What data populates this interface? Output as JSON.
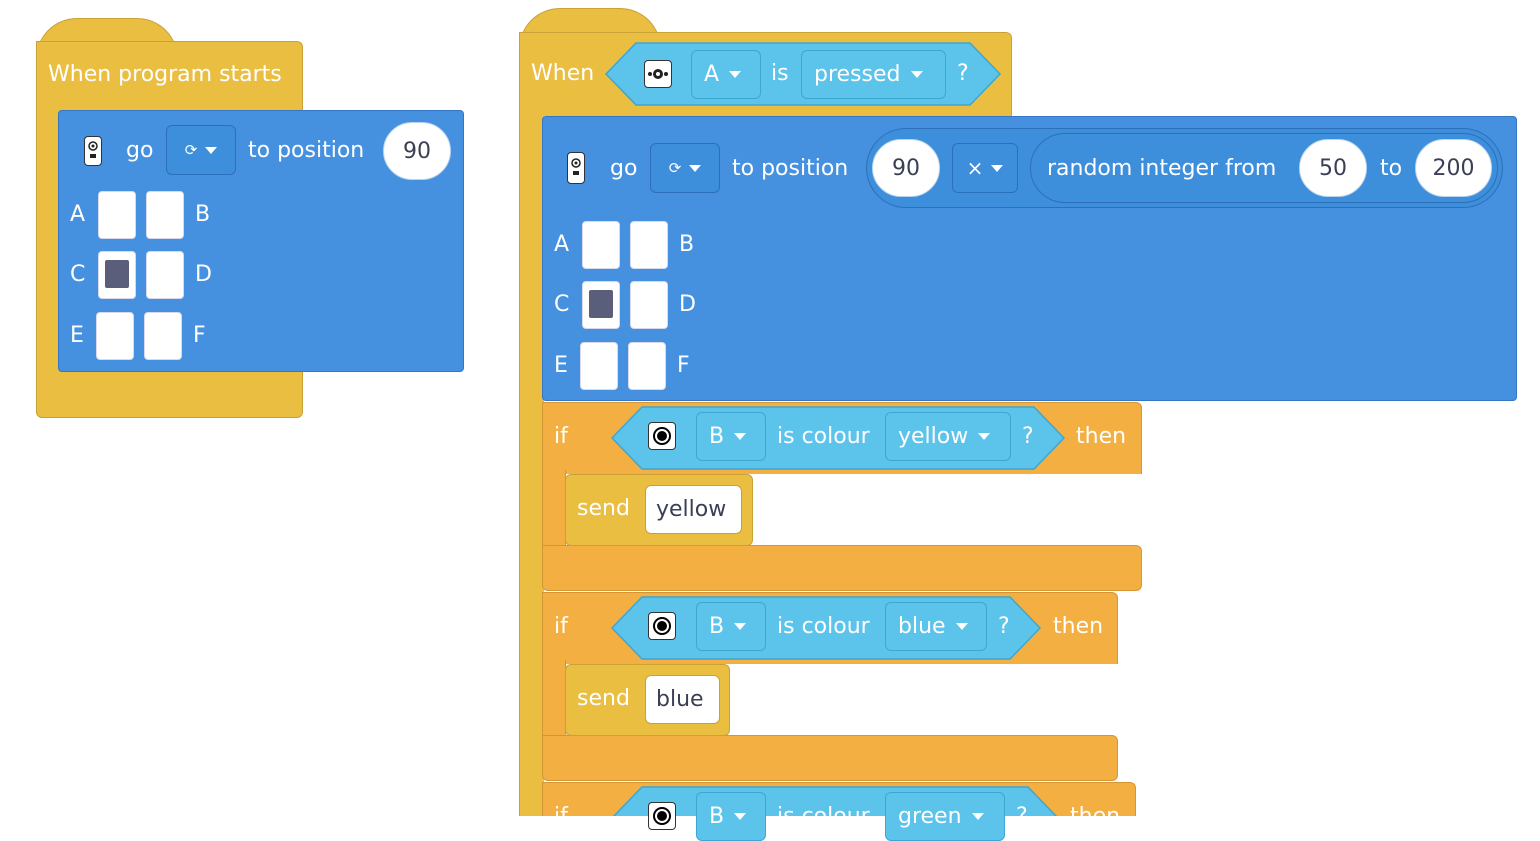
{
  "script1": {
    "hat_label": "When program starts",
    "go_label": "go",
    "direction_symbol": "⟳",
    "to_position_label": "to position",
    "position_value": "90",
    "grid_labels": [
      "A",
      "B",
      "C",
      "D",
      "E",
      "F"
    ],
    "selected_cell": "C"
  },
  "script2": {
    "hat_when": "When",
    "hat_button": "A",
    "hat_is": "is",
    "hat_state": "pressed",
    "hat_q": "?",
    "go_label": "go",
    "direction_symbol": "⟳",
    "to_position_label": "to position",
    "position_value": "90",
    "operator": "×",
    "random_label": "random integer from",
    "random_from": "50",
    "random_to_label": "to",
    "random_to": "200",
    "grid_labels": [
      "A",
      "B",
      "C",
      "D",
      "E",
      "F"
    ],
    "selected_cell": "C",
    "if_blocks": [
      {
        "if": "if",
        "sensor": "B",
        "is_colour": "is colour",
        "colour": "yellow",
        "q": "?",
        "then": "then",
        "send": "send",
        "message": "yellow"
      },
      {
        "if": "if",
        "sensor": "B",
        "is_colour": "is colour",
        "colour": "blue",
        "q": "?",
        "then": "then",
        "send": "send",
        "message": "blue"
      },
      {
        "if": "if",
        "sensor": "B",
        "is_colour": "is colour",
        "colour": "green",
        "q": "?",
        "then": "then"
      }
    ]
  },
  "colors": {
    "event": "#E9BE41",
    "motion": "#4591E0",
    "sensor": "#5CC3EB",
    "control": "#F3AF41"
  }
}
